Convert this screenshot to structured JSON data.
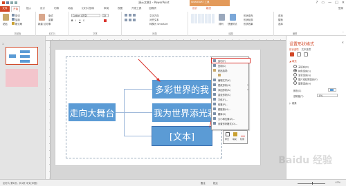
{
  "window": {
    "title": "演示文稿1 - PowerPoint",
    "controls": [
      "?",
      "▭",
      "—",
      "□",
      "✕"
    ]
  },
  "ribbon_context": {
    "group_label": "SMARTART 工具"
  },
  "tabs": [
    {
      "label": "文件",
      "kind": "file"
    },
    {
      "label": "开始",
      "kind": "active"
    },
    {
      "label": "插入",
      "kind": ""
    },
    {
      "label": "设计",
      "kind": ""
    },
    {
      "label": "切换",
      "kind": ""
    },
    {
      "label": "动画",
      "kind": ""
    },
    {
      "label": "幻灯片放映",
      "kind": ""
    },
    {
      "label": "审阅",
      "kind": ""
    },
    {
      "label": "视图",
      "kind": ""
    },
    {
      "label": "开发工具",
      "kind": ""
    },
    {
      "label": "加载项",
      "kind": ""
    },
    {
      "label": "设计",
      "kind": "ctx"
    },
    {
      "label": "格式",
      "kind": "ctx"
    }
  ],
  "user": "登录",
  "ribbon": {
    "clipboard": {
      "label": "剪贴板",
      "paste": "粘贴",
      "items": [
        "剪切",
        "复制",
        "格式刷"
      ]
    },
    "slides": {
      "label": "幻灯片",
      "new": "新建\n幻灯片",
      "items": [
        "版式",
        "重置",
        "节"
      ]
    },
    "font": {
      "label": "字体",
      "name": "Calibri (正文)",
      "size": "32"
    },
    "paragraph": {
      "label": "段落",
      "items": [
        "文字方向",
        "对齐文本",
        "转换为 SmartArt"
      ]
    },
    "drawing": {
      "label": "绘图",
      "arrange": "排列",
      "quick": "快速样式",
      "items": [
        "形状填充",
        "形状轮廓",
        "形状效果"
      ]
    },
    "editing": {
      "label": "编辑",
      "items": [
        "查找",
        "替换",
        "选择"
      ]
    }
  },
  "thumbnails": [
    {
      "num": "1"
    },
    {
      "num": ""
    }
  ],
  "smartart": {
    "root": "走向大舞台",
    "children": [
      "多彩世界的我",
      "我为世界添光彩",
      "[文本]"
    ]
  },
  "context_menu": {
    "items": [
      {
        "label": "剪切(T)",
        "highlight": true,
        "arrow": false
      },
      {
        "label": "复制(C)",
        "highlight": false,
        "arrow": false
      },
      {
        "label": "粘贴选项:",
        "highlight": false,
        "arrow": false
      },
      {
        "label": "",
        "highlight": false,
        "arrow": false
      },
      {
        "label": "编辑文字(X)",
        "highlight": false,
        "arrow": false
      },
      {
        "label": "更改形状(H)",
        "highlight": false,
        "arrow": true
      },
      {
        "label": "添加形状(A)",
        "highlight": false,
        "arrow": true
      },
      {
        "label": "重设形状(S)",
        "highlight": false,
        "arrow": false
      },
      {
        "label": "字体(F)...",
        "highlight": false,
        "arrow": false
      },
      {
        "label": "段落(P)...",
        "highlight": false,
        "arrow": false
      },
      {
        "label": "超链接(H)...",
        "highlight": false,
        "arrow": false
      },
      {
        "label": "翻译(S)",
        "highlight": false,
        "arrow": false
      },
      {
        "label": "大小和位置(Z)...",
        "highlight": false,
        "arrow": false
      },
      {
        "label": "设置形状格式(O)...",
        "highlight": false,
        "arrow": false
      },
      {
        "label": "",
        "highlight": false,
        "arrow": false
      }
    ],
    "mini_toolbar": [
      "样式",
      "填充",
      "轮廓"
    ]
  },
  "format_pane": {
    "title": "设置形状格式",
    "tabs": [
      "形状选项",
      "文本选项"
    ],
    "section_fill": "填充",
    "fill_options": [
      {
        "label": "无填充(N)",
        "on": false
      },
      {
        "label": "纯色填充(S)",
        "on": true
      },
      {
        "label": "渐变填充(G)",
        "on": false
      },
      {
        "label": "图片或纹理填充(P)",
        "on": false
      },
      {
        "label": "图案填充(A)",
        "on": false
      }
    ],
    "color_label": "颜色(C)",
    "transparency_label": "透明度(T)",
    "transparency_value": "0%",
    "section_line": "线条"
  },
  "status": {
    "left": "幻灯片 第1张，共1张    中文(中国)",
    "notes": "备注",
    "comments": "批注",
    "zoom": "47%"
  },
  "watermark": "Baidu 经验"
}
